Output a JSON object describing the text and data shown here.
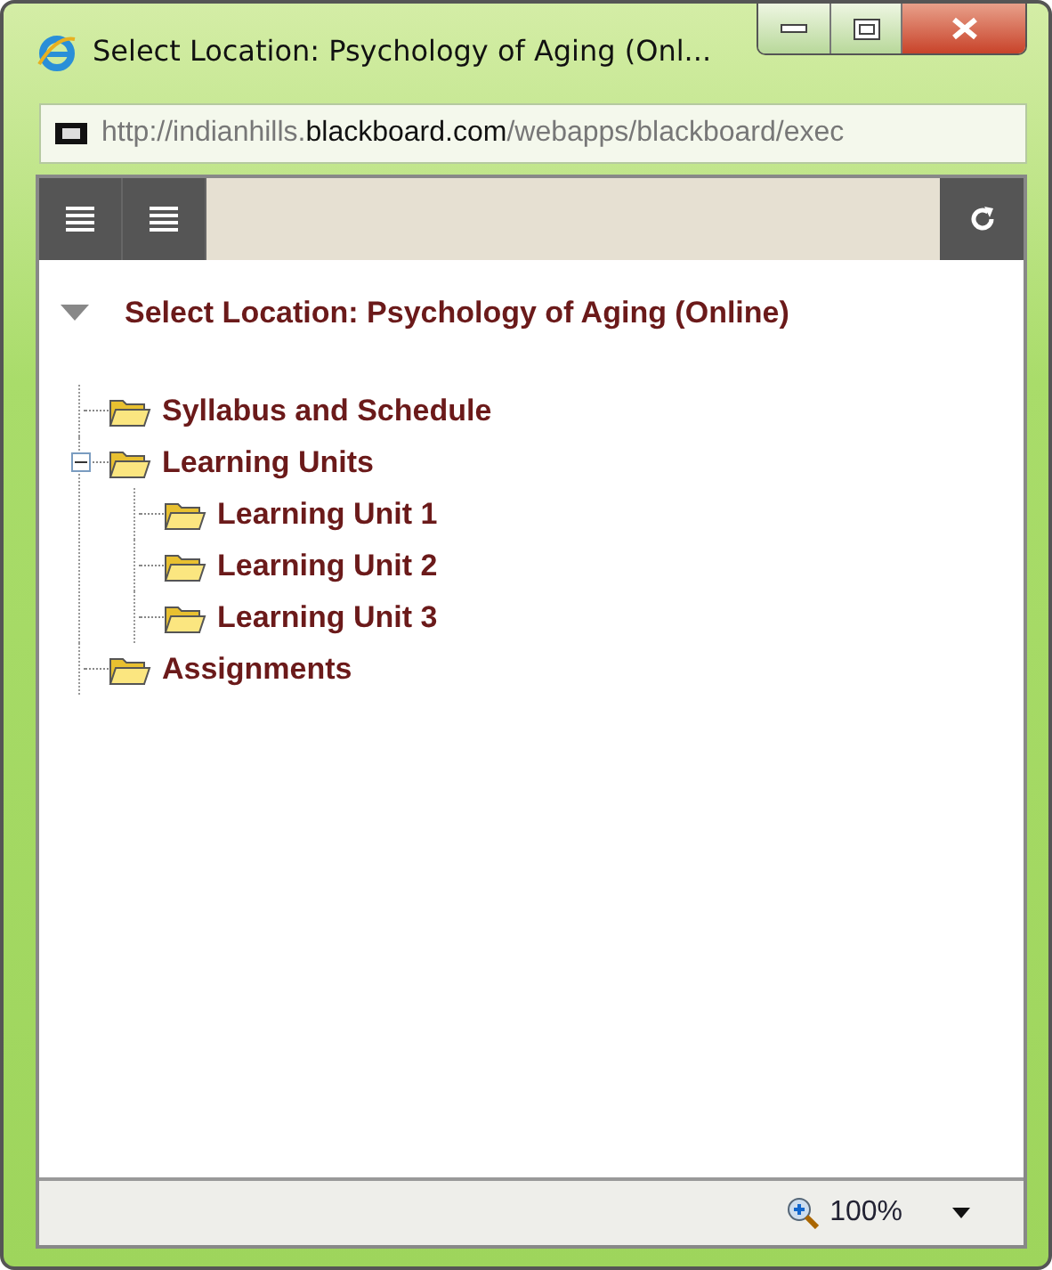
{
  "window": {
    "title": "Select Location: Psychology of Aging (Onl..."
  },
  "address": {
    "prefix": "http://indianhills.",
    "domain": "blackboard.com",
    "path": "/webapps/blackboard/exec"
  },
  "heading": {
    "text": "Select Location: Psychology of Aging (Online)",
    "expanded": true
  },
  "tree": [
    {
      "label": "Syllabus and Schedule"
    },
    {
      "label": "Learning Units",
      "expanded": true,
      "children": [
        {
          "label": "Learning Unit 1"
        },
        {
          "label": "Learning Unit 2"
        },
        {
          "label": "Learning Unit 3"
        }
      ]
    },
    {
      "label": "Assignments"
    }
  ],
  "status_bar": {
    "zoom": "100%"
  }
}
